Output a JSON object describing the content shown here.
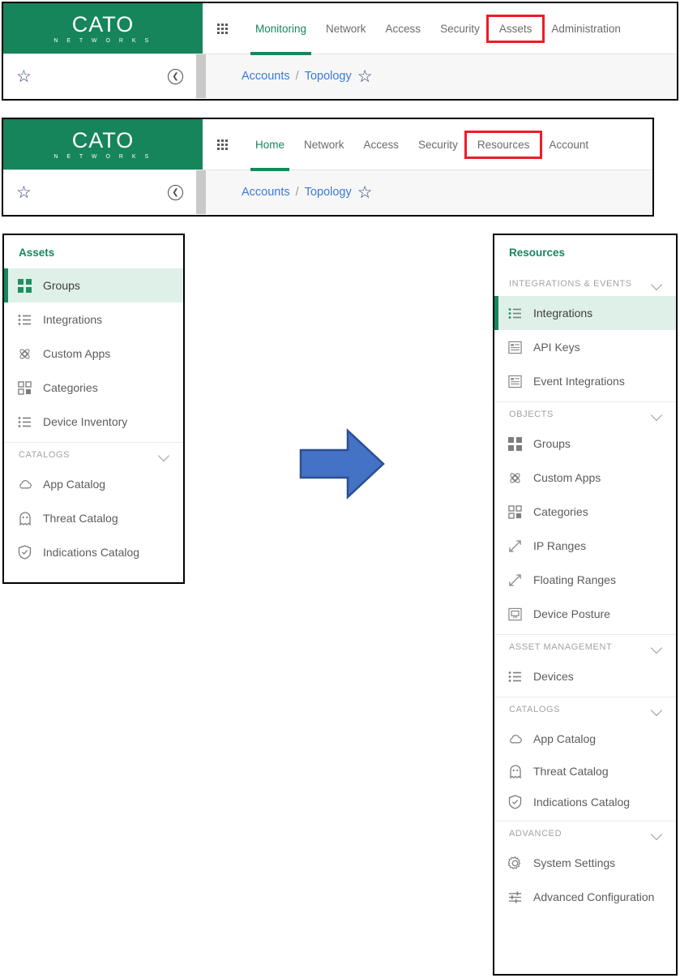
{
  "brand": {
    "logo_word": "CATO",
    "logo_sub": "N E T W O R K S",
    "green": "#16855c",
    "highlight_red": "#ee1c25",
    "selected_bg": "#dff0e8",
    "link_blue": "#3a7bd5",
    "arrow_blue": "#4472c4"
  },
  "appbar_before": {
    "nav": [
      {
        "label": "Monitoring",
        "state": "active"
      },
      {
        "label": "Network",
        "state": "normal"
      },
      {
        "label": "Access",
        "state": "normal"
      },
      {
        "label": "Security",
        "state": "normal"
      },
      {
        "label": "Assets",
        "state": "highlighted"
      },
      {
        "label": "Administration",
        "state": "normal"
      }
    ],
    "breadcrumb": {
      "root": "Accounts",
      "separator": "/",
      "current": "Topology"
    }
  },
  "appbar_after": {
    "nav": [
      {
        "label": "Home",
        "state": "active"
      },
      {
        "label": "Network",
        "state": "normal"
      },
      {
        "label": "Access",
        "state": "normal"
      },
      {
        "label": "Security",
        "state": "normal"
      },
      {
        "label": "Resources",
        "state": "highlighted"
      },
      {
        "label": "Account",
        "state": "normal"
      }
    ],
    "breadcrumb": {
      "root": "Accounts",
      "separator": "/",
      "current": "Topology"
    }
  },
  "sidebar_before": {
    "title": "Assets",
    "items": [
      {
        "label": "Groups",
        "icon": "grid-squares-icon",
        "selected": true
      },
      {
        "label": "Integrations",
        "icon": "list-icon",
        "selected": false
      },
      {
        "label": "Custom Apps",
        "icon": "atom-icon",
        "selected": false
      },
      {
        "label": "Categories",
        "icon": "category-grid-icon",
        "selected": false
      },
      {
        "label": "Device Inventory",
        "icon": "list-icon",
        "selected": false
      }
    ],
    "groups": [
      {
        "header": "CATALOGS",
        "items": [
          {
            "label": "App Catalog",
            "icon": "cloud-icon"
          },
          {
            "label": "Threat Catalog",
            "icon": "ghost-icon"
          },
          {
            "label": "Indications Catalog",
            "icon": "shield-check-icon"
          }
        ]
      }
    ]
  },
  "sidebar_after": {
    "title": "Resources",
    "groups": [
      {
        "header": "INTEGRATIONS & EVENTS",
        "items": [
          {
            "label": "Integrations",
            "icon": "list-icon",
            "selected": true
          },
          {
            "label": "API Keys",
            "icon": "document-list-icon",
            "selected": false
          },
          {
            "label": "Event Integrations",
            "icon": "document-list-icon",
            "selected": false
          }
        ]
      },
      {
        "header": "OBJECTS",
        "items": [
          {
            "label": "Groups",
            "icon": "grid-squares-icon",
            "selected": false
          },
          {
            "label": "Custom Apps",
            "icon": "atom-icon",
            "selected": false
          },
          {
            "label": "Categories",
            "icon": "category-grid-icon",
            "selected": false
          },
          {
            "label": "IP Ranges",
            "icon": "expand-arrows-icon",
            "selected": false
          },
          {
            "label": "Floating Ranges",
            "icon": "expand-arrows-icon",
            "selected": false
          },
          {
            "label": "Device Posture",
            "icon": "monitor-icon",
            "selected": false
          }
        ]
      },
      {
        "header": "ASSET MANAGEMENT",
        "items": [
          {
            "label": "Devices",
            "icon": "list-icon",
            "selected": false
          }
        ]
      },
      {
        "header": "CATALOGS",
        "items": [
          {
            "label": "App Catalog",
            "icon": "cloud-icon",
            "selected": false
          },
          {
            "label": "Threat Catalog",
            "icon": "ghost-icon",
            "selected": false
          },
          {
            "label": "Indications Catalog",
            "icon": "shield-check-icon",
            "selected": false
          }
        ]
      },
      {
        "header": "ADVANCED",
        "items": [
          {
            "label": "System Settings",
            "icon": "gear-icon",
            "selected": false
          },
          {
            "label": "Advanced Configuration",
            "icon": "sliders-icon",
            "selected": false
          }
        ]
      }
    ]
  },
  "transition_arrow": {
    "direction": "right",
    "meaning": "renamed-to"
  }
}
